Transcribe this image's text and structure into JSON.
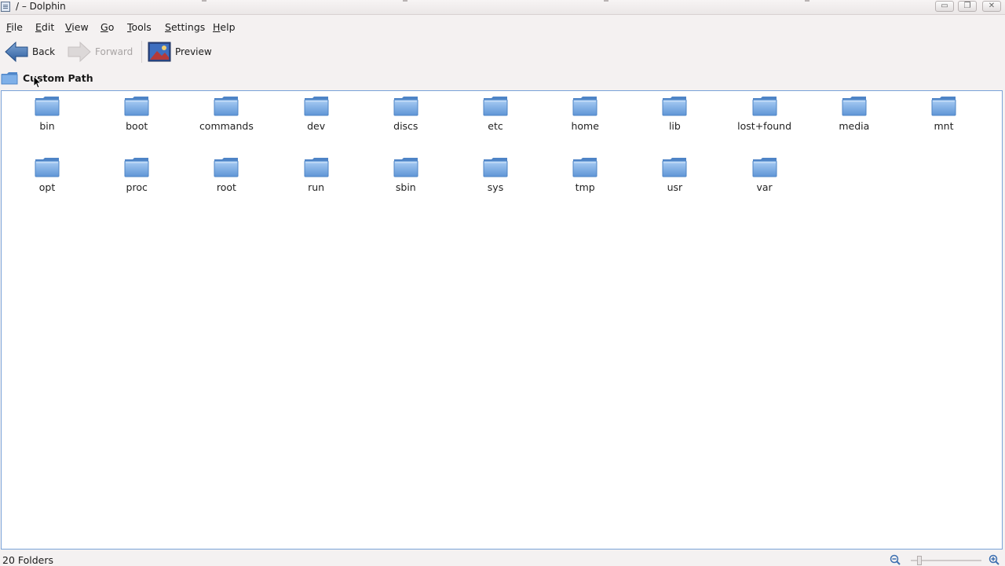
{
  "window": {
    "title": "/ – Dolphin",
    "controls": [
      "minimize",
      "maximize",
      "close"
    ]
  },
  "menubar": {
    "items": [
      {
        "label": "File",
        "underline": "F"
      },
      {
        "label": "Edit",
        "underline": "E"
      },
      {
        "label": "View",
        "underline": "V"
      },
      {
        "label": "Go",
        "underline": "G"
      },
      {
        "label": "Tools",
        "underline": "T"
      },
      {
        "label": "Settings",
        "underline": "S"
      },
      {
        "label": "Help",
        "underline": "H"
      }
    ]
  },
  "toolbar": {
    "back_label": "Back",
    "forward_label": "Forward",
    "preview_label": "Preview",
    "forward_enabled": false
  },
  "location": {
    "label": "Custom Path",
    "icon": "folder-icon"
  },
  "folders": [
    "bin",
    "boot",
    "commands",
    "dev",
    "discs",
    "etc",
    "home",
    "lib",
    "lost+found",
    "media",
    "mnt",
    "opt",
    "proc",
    "root",
    "run",
    "sbin",
    "sys",
    "tmp",
    "usr",
    "var"
  ],
  "status": {
    "text": "20 Folders",
    "zoom_level": 0.1
  },
  "colors": {
    "folder": "#6e9fd8",
    "view_border": "#7aa3d8",
    "background": "#f4f1f1"
  }
}
